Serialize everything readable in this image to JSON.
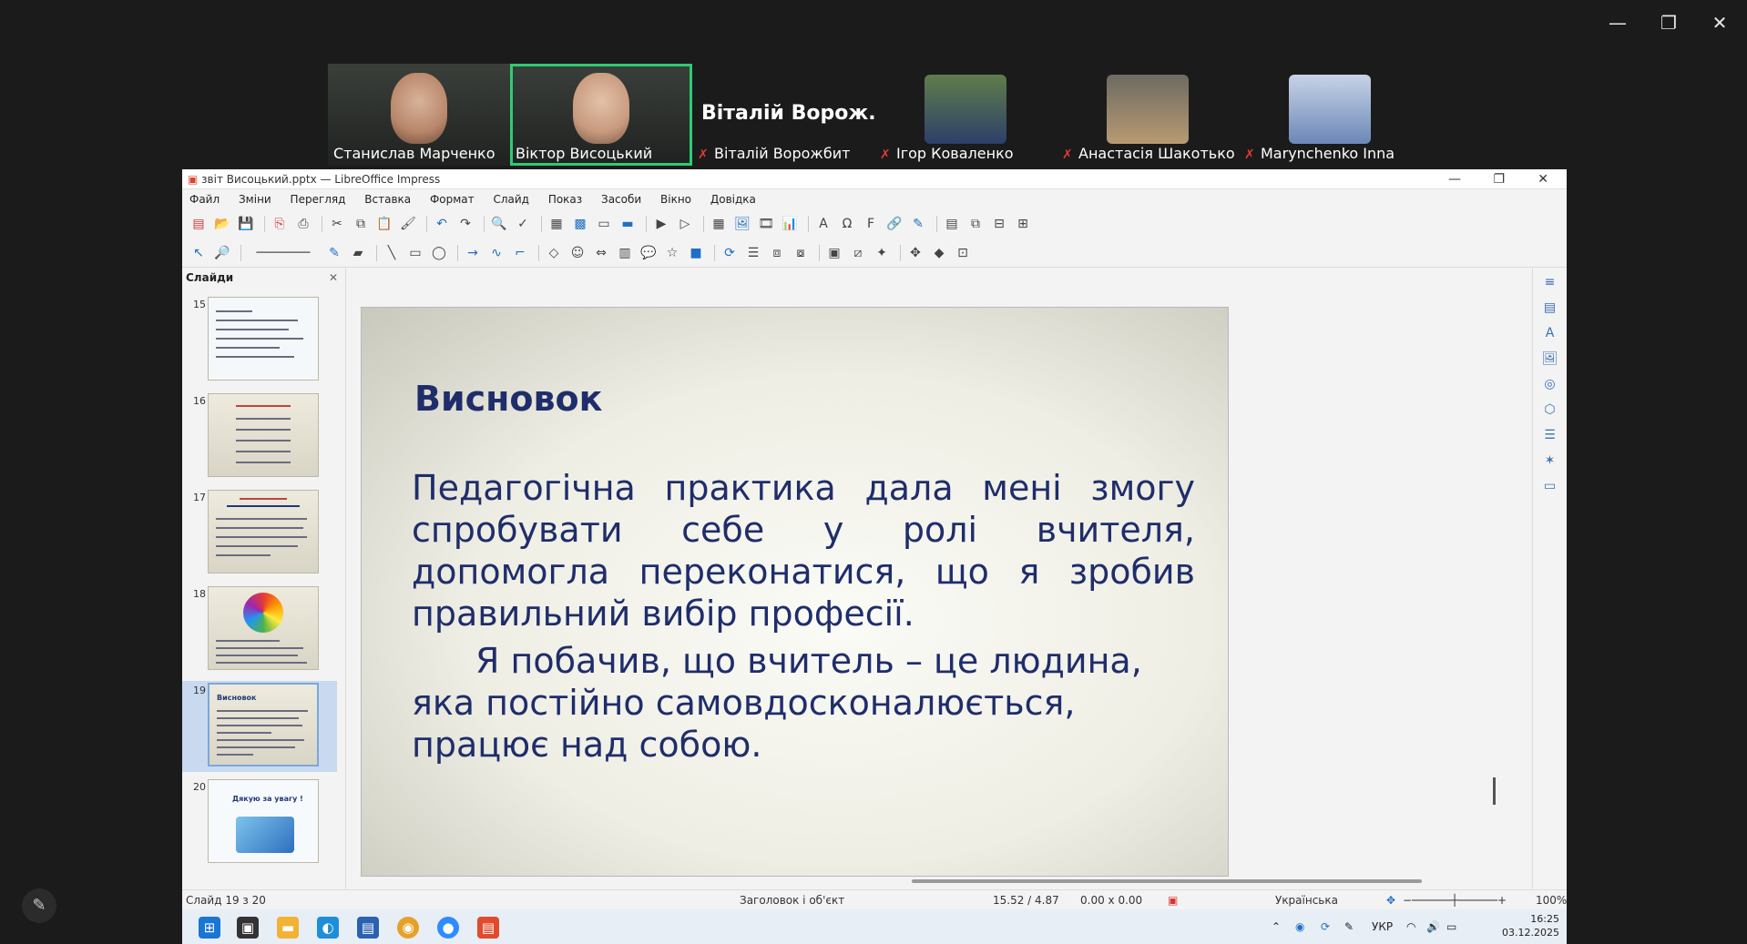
{
  "zoom": {
    "participants": [
      {
        "name": "Станислав Марченко",
        "video": true,
        "muted": false
      },
      {
        "name": "Віктор Висоцький",
        "video": true,
        "muted": false,
        "active_speaker": true
      },
      {
        "name": "Віталій Ворожбит",
        "display_title": "Віталій Ворож...",
        "video": false,
        "muted": true
      },
      {
        "name": "Ігор Коваленко",
        "video": false,
        "muted": true
      },
      {
        "name": "Анастасія Шакотько",
        "video": false,
        "muted": true
      },
      {
        "name": "Marynchenko Inna",
        "video": false,
        "muted": true
      }
    ],
    "window_controls": {
      "minimize": "—",
      "restore": "❐",
      "close": "✕"
    },
    "annotate_icon": "pencil-icon"
  },
  "app": {
    "title": "звіт Висоцький.pptx — LibreOffice Impress",
    "menu": [
      "Файл",
      "Зміни",
      "Перегляд",
      "Вставка",
      "Формат",
      "Слайд",
      "Показ",
      "Засоби",
      "Вікно",
      "Довідка"
    ],
    "sidebar_title": "Слайди",
    "slides": [
      {
        "num": "15",
        "title": ""
      },
      {
        "num": "16",
        "title": ""
      },
      {
        "num": "17",
        "title": ""
      },
      {
        "num": "18",
        "title": ""
      },
      {
        "num": "19",
        "title": "Висновок",
        "selected": true
      },
      {
        "num": "20",
        "title": "Дякую за увагу !"
      }
    ]
  },
  "slide": {
    "title": "Висновок",
    "paragraph1": "Педагогічна практика дала мені змогу спробувати себе у ролі вчителя, допомогла переконатися, що я зробив правильний вибір професії.",
    "paragraph2": "Я побачив, що вчитель – це людина, яка постійно самовдосконалюється, працює над собою."
  },
  "status": {
    "slide_counter": "Слайд 19 з 20",
    "layout": "Заголовок і об'єкт",
    "position": "15.52 / 4.87",
    "size": "0.00 x 0.00",
    "language": "Українська",
    "zoom": "100%"
  },
  "taskbar": {
    "lang": "УКР",
    "time": "16:25",
    "date": "03.12.2025"
  }
}
